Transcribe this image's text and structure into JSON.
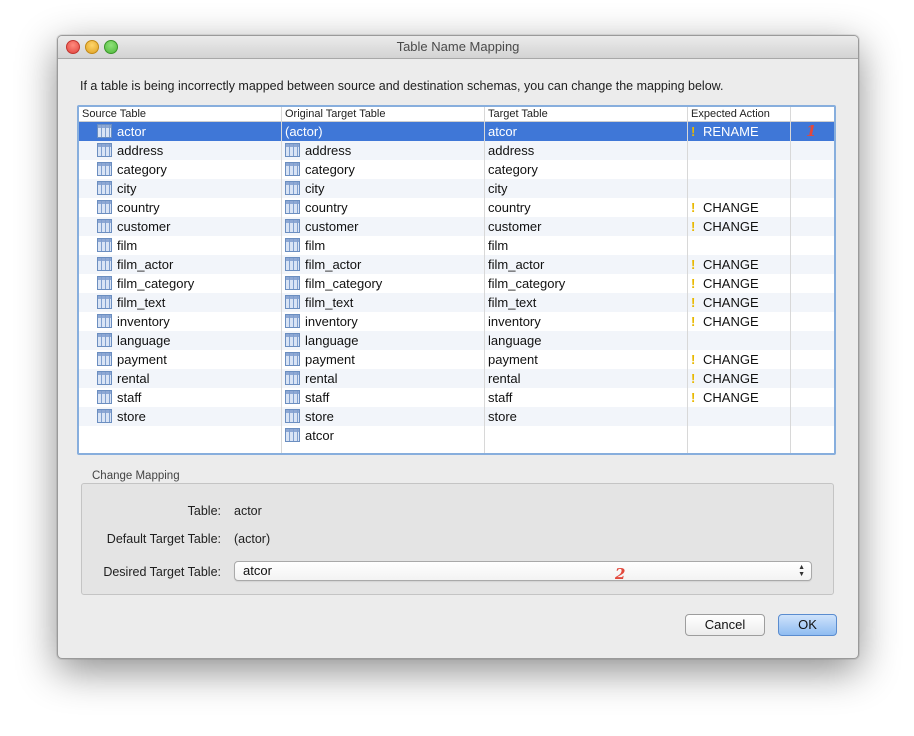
{
  "window": {
    "title": "Table Name Mapping"
  },
  "description": "If a table is being incorrectly mapped between source and destination schemas, you can change the mapping below.",
  "table": {
    "columns": [
      "Source Table",
      "Original Target Table",
      "Target Table",
      "Expected Action"
    ],
    "rows": [
      {
        "source": "actor",
        "original": "(actor)",
        "target": "atcor",
        "action": "RENAME",
        "warn": true,
        "selected": true
      },
      {
        "source": "address",
        "original": "address",
        "target": "address",
        "action": "",
        "warn": false
      },
      {
        "source": "category",
        "original": "category",
        "target": "category",
        "action": "",
        "warn": false
      },
      {
        "source": "city",
        "original": "city",
        "target": "city",
        "action": "",
        "warn": false
      },
      {
        "source": "country",
        "original": "country",
        "target": "country",
        "action": "CHANGE",
        "warn": true
      },
      {
        "source": "customer",
        "original": "customer",
        "target": "customer",
        "action": "CHANGE",
        "warn": true
      },
      {
        "source": "film",
        "original": "film",
        "target": "film",
        "action": "",
        "warn": false
      },
      {
        "source": "film_actor",
        "original": "film_actor",
        "target": "film_actor",
        "action": "CHANGE",
        "warn": true
      },
      {
        "source": "film_category",
        "original": "film_category",
        "target": "film_category",
        "action": "CHANGE",
        "warn": true
      },
      {
        "source": "film_text",
        "original": "film_text",
        "target": "film_text",
        "action": "CHANGE",
        "warn": true
      },
      {
        "source": "inventory",
        "original": "inventory",
        "target": "inventory",
        "action": "CHANGE",
        "warn": true
      },
      {
        "source": "language",
        "original": "language",
        "target": "language",
        "action": "",
        "warn": false
      },
      {
        "source": "payment",
        "original": "payment",
        "target": "payment",
        "action": "CHANGE",
        "warn": true
      },
      {
        "source": "rental",
        "original": "rental",
        "target": "rental",
        "action": "CHANGE",
        "warn": true
      },
      {
        "source": "staff",
        "original": "staff",
        "target": "staff",
        "action": "CHANGE",
        "warn": true
      },
      {
        "source": "store",
        "original": "store",
        "target": "store",
        "action": "",
        "warn": false
      },
      {
        "source": "",
        "original": "atcor",
        "target": "",
        "action": "",
        "warn": false
      }
    ],
    "warn_symbol": "!",
    "warn_color": "#e8b800",
    "selection_color": "#3f77d7"
  },
  "change_mapping": {
    "group_title": "Change Mapping",
    "table_label": "Table:",
    "table_value": "actor",
    "default_label": "Default Target Table:",
    "default_value": "(actor)",
    "desired_label": "Desired Target Table:",
    "desired_value": "atcor"
  },
  "annotations": {
    "marker_1": "1",
    "marker_2": "2",
    "color": "#e2483c"
  },
  "buttons": {
    "cancel": "Cancel",
    "ok": "OK"
  }
}
